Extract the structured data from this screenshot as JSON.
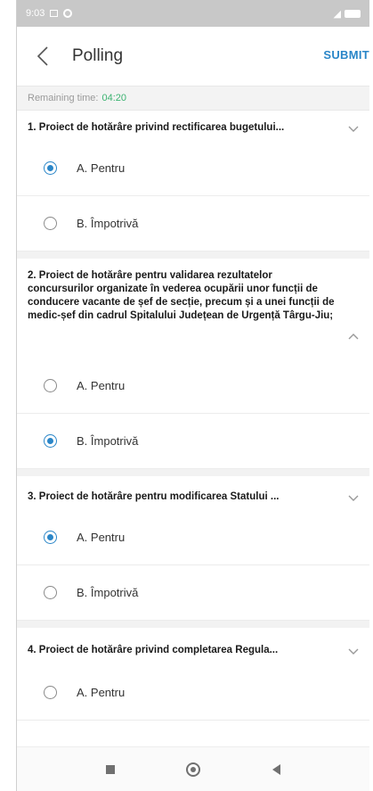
{
  "status_bar": {
    "time": "9:03"
  },
  "header": {
    "title": "Polling",
    "submit_label": "SUBMIT"
  },
  "remaining": {
    "label": "Remaining time:",
    "value": "04:20"
  },
  "questions": [
    {
      "text": "1. Proiect de hotărâre privind rectificarea bugetului...",
      "options": [
        {
          "label": "A. Pentru",
          "selected": true
        },
        {
          "label": "B. Împotrivă",
          "selected": false
        }
      ]
    },
    {
      "text": "2. Proiect de hotărâre pentru validarea rezultatelor concursurilor organizate în vederea ocupării unor funcții de conducere vacante de șef de secție, precum și a unei funcții de medic-șef din cadrul Spitalului Județean de Urgență Târgu-Jiu;",
      "options": [
        {
          "label": "A. Pentru",
          "selected": false
        },
        {
          "label": "B. Împotrivă",
          "selected": true
        }
      ]
    },
    {
      "text": "3. Proiect de hotărâre pentru modificarea Statului ...",
      "options": [
        {
          "label": "A. Pentru",
          "selected": true
        },
        {
          "label": "B. Împotrivă",
          "selected": false
        }
      ]
    },
    {
      "text": "4. Proiect de hotărâre privind completarea Regula...",
      "options": [
        {
          "label": "A. Pentru",
          "selected": false
        }
      ]
    }
  ],
  "colors": {
    "accent": "#2a86c8",
    "timer": "#3cb371"
  }
}
